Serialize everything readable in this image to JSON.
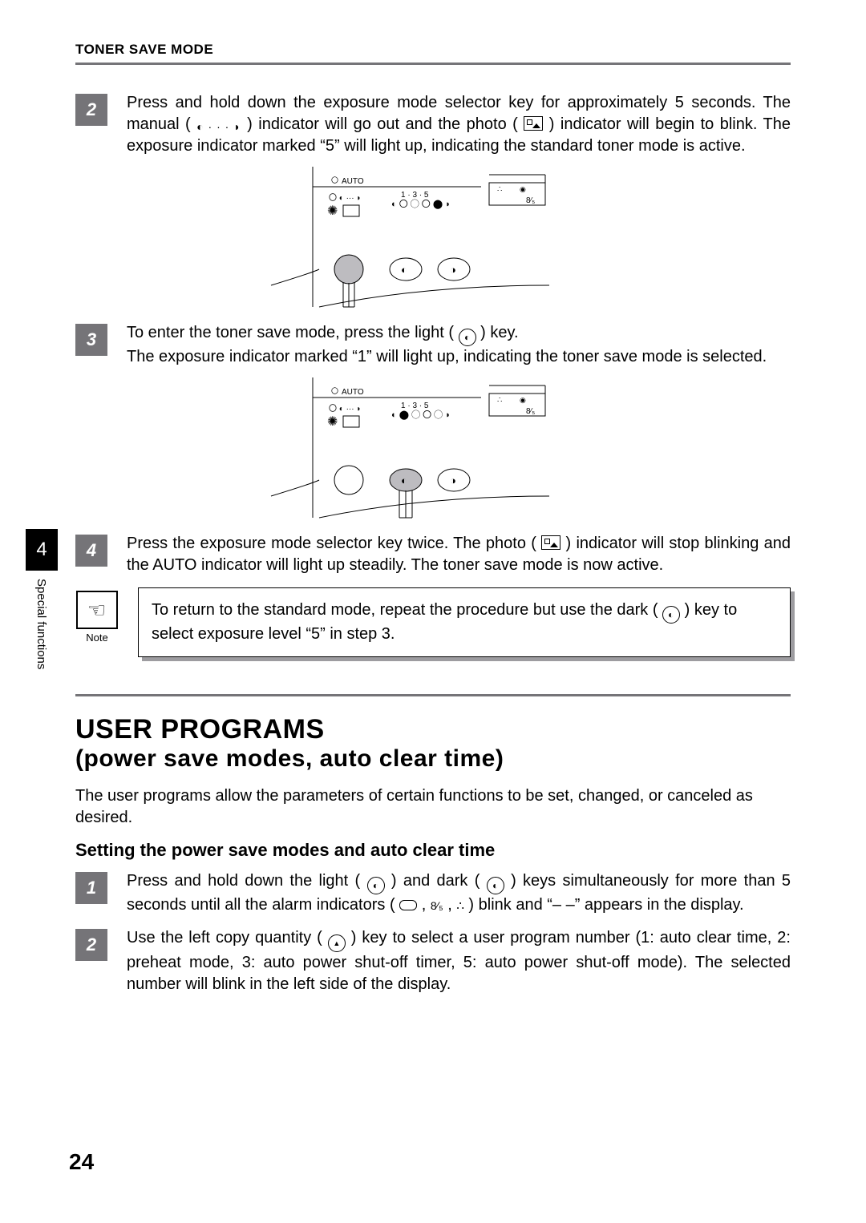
{
  "running_head": "TONER SAVE MODE",
  "side_tab": {
    "chapter": "4",
    "label": "Special functions"
  },
  "page_number": "24",
  "steps_a": {
    "s2_num": "2",
    "s2_p1": "Press and hold down the exposure mode selector key for approximately 5 seconds. The manual (",
    "s2_p2": ") indicator will go out and the photo (",
    "s2_p3": ") indicator will begin to blink. The exposure indicator marked “5” will light up, indicating the standard toner mode is active.",
    "s3_num": "3",
    "s3_p1": "To enter the toner save mode, press the light (",
    "s3_p2": ") key.",
    "s3_p3": "The exposure indicator marked “1” will light up, indicating the toner save mode is selected.",
    "s4_num": "4",
    "s4_p1": "Press the exposure mode selector key twice. The photo (",
    "s4_p2": ") indicator will stop blinking and the AUTO indicator will light up steadily. The toner save mode is now active."
  },
  "note": {
    "label": "Note",
    "p1": "To return to the standard mode, repeat the procedure but use the dark (",
    "p2": ") key to select exposure level “5” in step 3."
  },
  "section": {
    "title": "USER PROGRAMS",
    "subtitle": "(power save modes, auto clear time)",
    "intro": "The user programs allow the parameters of certain functions to be set, changed, or canceled as desired.",
    "subhead": "Setting the power save modes and auto clear time"
  },
  "steps_b": {
    "s1_num": "1",
    "s1_p1": "Press and hold down the light (",
    "s1_p2": ") and dark (",
    "s1_p3": ") keys simultaneously for more than 5 seconds until all the alarm indicators (",
    "s1_p4": ",  ",
    "s1_p5": ",  ",
    "s1_p6": " ) blink and “– –” appears in the display.",
    "s2_num": "2",
    "s2_p1": "Use the left copy quantity (",
    "s2_p2": ") key to select a user program number (1: auto clear time, 2: preheat mode, 3: auto power shut-off timer, 5: auto power shut-off mode). The selected number will blink in the left side of the display."
  },
  "diagram": {
    "auto": "AUTO",
    "scale": "1 · 3 · 5"
  }
}
